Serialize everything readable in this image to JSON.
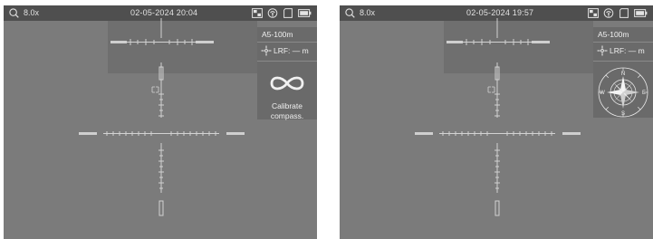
{
  "colors": {
    "screen_bg": "#7b7b7b",
    "statusbar_bg": "#4f4f4f",
    "panel_bg": "#6a6a6a",
    "text": "#e2e2e2"
  },
  "left": {
    "statusbar": {
      "zoom": "8.0x",
      "datetime": "02-05-2024 20:04",
      "icons": [
        "picture-in-picture-icon",
        "hotspot-icon",
        "sd-card-icon",
        "battery-icon"
      ]
    },
    "panel": {
      "mode": "A5-100m",
      "lrf": "LRF: — m",
      "calibrate_line1": "Calibrate",
      "calibrate_line2": "compass.",
      "calibrate_icon": "figure-eight-icon"
    }
  },
  "right": {
    "statusbar": {
      "zoom": "8.0x",
      "datetime": "02-05-2024 19:57",
      "icons": [
        "picture-in-picture-icon",
        "hotspot-icon",
        "sd-card-icon",
        "battery-icon"
      ]
    },
    "panel": {
      "mode": "A5-100m",
      "lrf": "LRF: — m",
      "compass": {
        "n": "N",
        "e": "E",
        "s": "S",
        "w": "W",
        "icon": "compass-icon"
      }
    }
  }
}
